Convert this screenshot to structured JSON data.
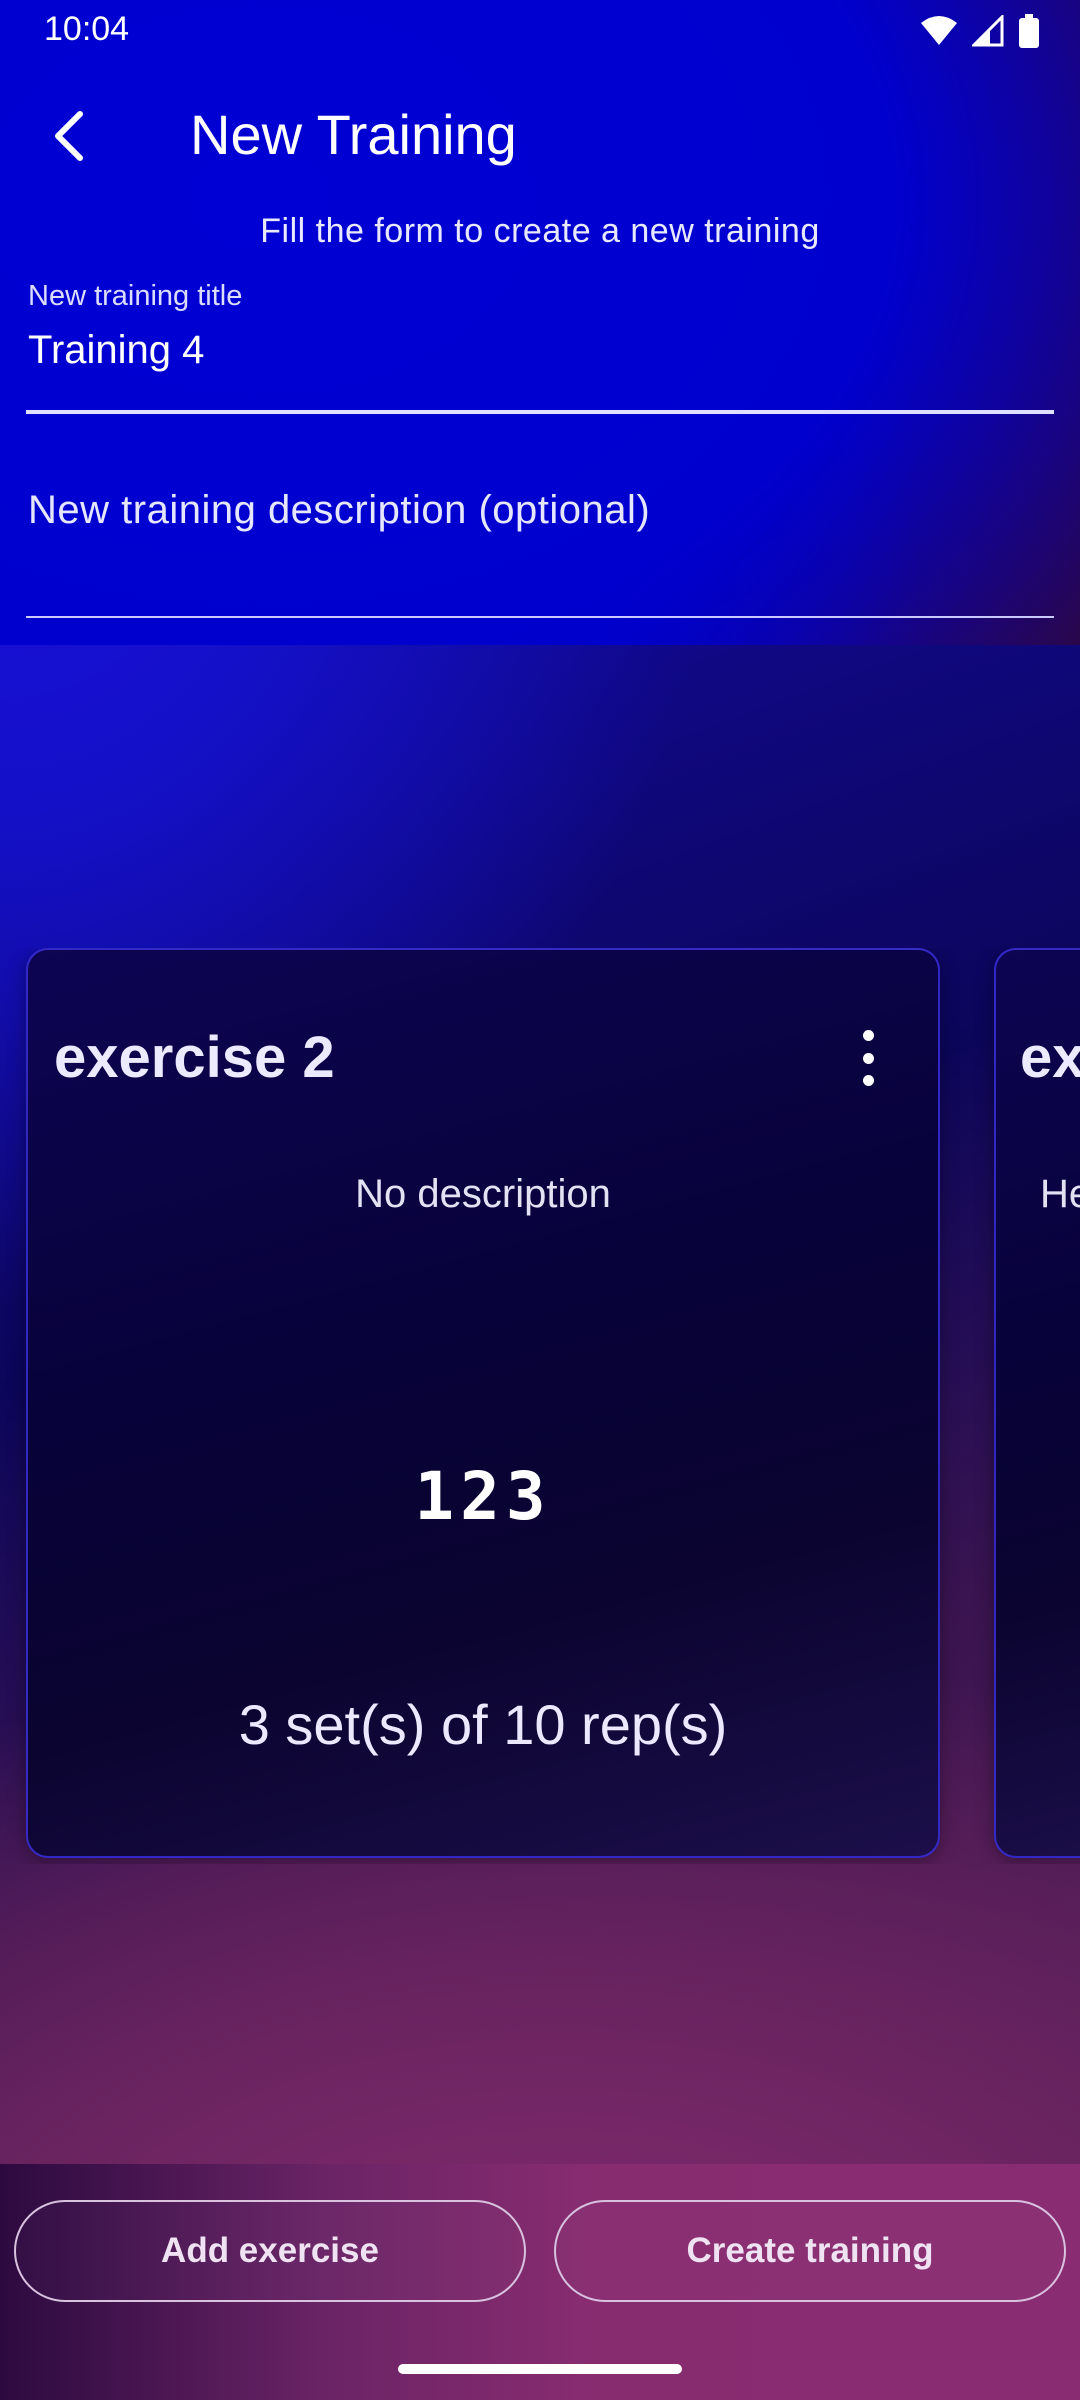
{
  "status_bar": {
    "time": "10:04",
    "icons": [
      "wifi-icon",
      "signal-icon",
      "battery-icon"
    ]
  },
  "app_bar": {
    "back_icon": "chevron-left-icon",
    "title": "New Training"
  },
  "form": {
    "subtitle": "Fill the form to create a new training",
    "title_field": {
      "label": "New training title",
      "value": "Training 4"
    },
    "description_field": {
      "placeholder": "New training description (optional)",
      "value": ""
    }
  },
  "exercises": [
    {
      "title": "exercise 2",
      "description": "No description",
      "code": "123",
      "sets": "3 set(s) of 10 rep(s)"
    },
    {
      "title_peek": "ex",
      "description_peek": "He"
    }
  ],
  "actions": {
    "add_exercise": "Add exercise",
    "create_training": "Create training"
  },
  "colors": {
    "primary_blue": "#0000cc",
    "card_bg": "#070238",
    "bottom_bar": "#882c70",
    "text": "#ffffff"
  }
}
